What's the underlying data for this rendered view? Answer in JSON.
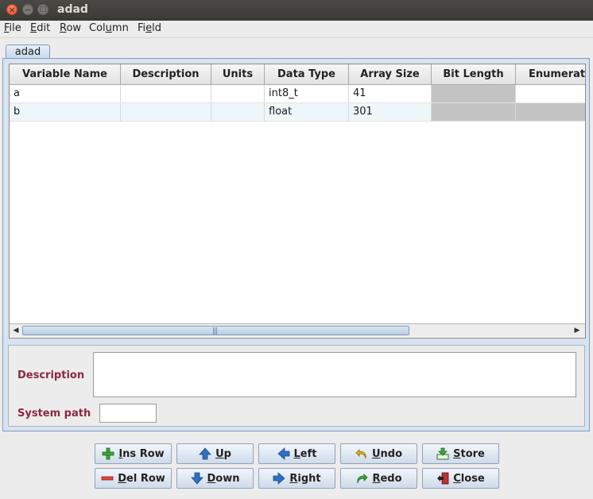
{
  "window": {
    "title": "adad"
  },
  "menu": [
    {
      "mnemonic": "F",
      "rest": "ile"
    },
    {
      "mnemonic": "E",
      "rest": "dit"
    },
    {
      "mnemonic": "R",
      "rest": "ow"
    },
    {
      "pre": "Col",
      "mnemonic": "u",
      "rest": "mn"
    },
    {
      "pre": "Fi",
      "mnemonic": "e",
      "rest": "ld"
    }
  ],
  "tab": {
    "label": "adad"
  },
  "table": {
    "columns": [
      "Variable Name",
      "Description",
      "Units",
      "Data Type",
      "Array Size",
      "Bit Length",
      "Enumerat"
    ],
    "rows": [
      [
        "a",
        "",
        "",
        "int8_t",
        "41",
        "",
        ""
      ],
      [
        "b",
        "",
        "",
        "float",
        "301",
        "",
        ""
      ]
    ]
  },
  "form": {
    "description_label": "Description",
    "description_value": "",
    "system_path_label": "System path",
    "system_path_value": ""
  },
  "buttons": {
    "ins_row": {
      "mn": "I",
      "rest": "ns Row"
    },
    "up": {
      "mn": "U",
      "rest": "p"
    },
    "left": {
      "mn": "L",
      "rest": "eft"
    },
    "undo": {
      "mn": "U",
      "rest": "ndo"
    },
    "store": {
      "mn": "S",
      "rest": "tore"
    },
    "del_row": {
      "mn": "D",
      "rest": "el Row"
    },
    "down": {
      "mn": "D",
      "rest": "own"
    },
    "right": {
      "mn": "R",
      "rest": "ight"
    },
    "redo": {
      "mn": "R",
      "rest": "edo"
    },
    "close": {
      "mn": "C",
      "rest": "lose"
    }
  },
  "colors": {
    "form_label": "#8c2742",
    "disabled_cell": "#c4c4c4",
    "alt_row": "#eef6fa"
  }
}
